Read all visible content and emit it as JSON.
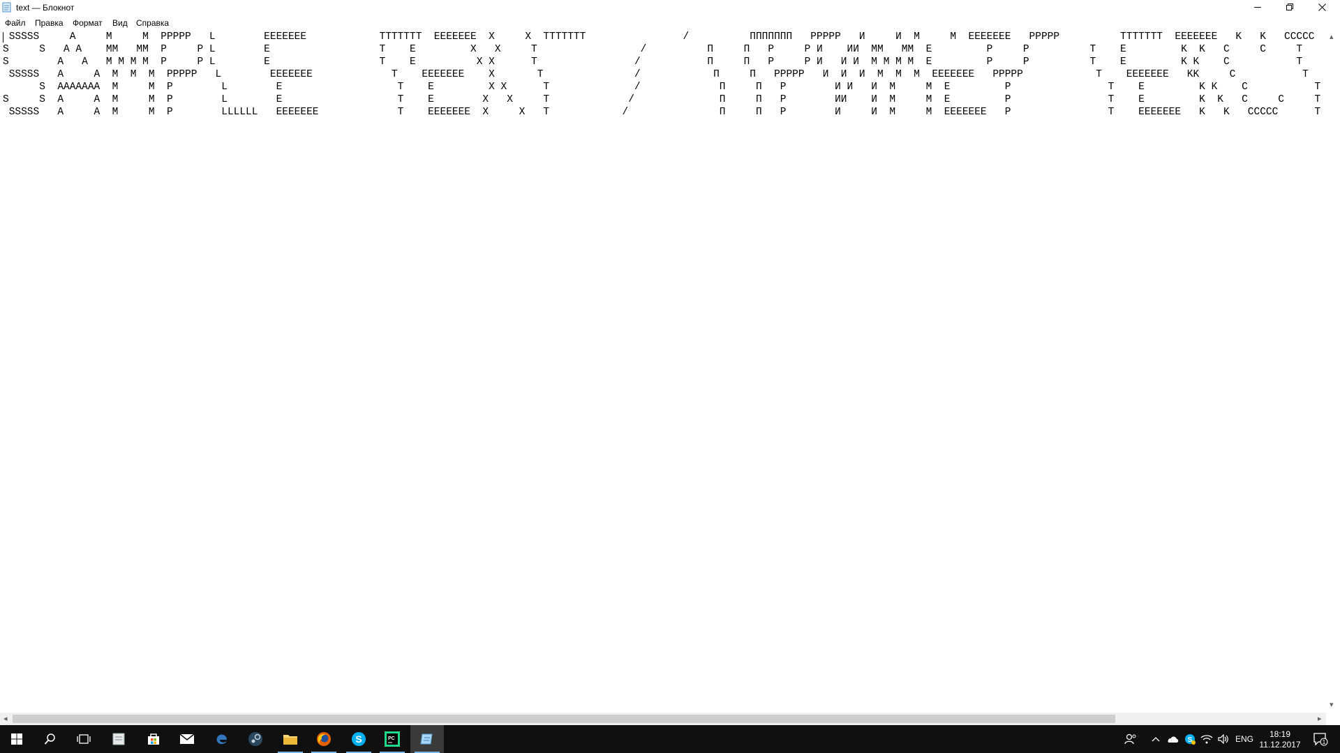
{
  "window": {
    "title": "text — Блокнот",
    "icon": "notepad-icon",
    "controls": [
      "minimize-icon",
      "restore-icon",
      "close-icon"
    ]
  },
  "menu": {
    "file": "Файл",
    "edit": "Правка",
    "format": "Формат",
    "view": "Вид",
    "help": "Справка"
  },
  "editor": {
    "content": " SSSSS     A     M     M  PPPPP   L        EEEEEEE            TTTTTTT  EEEEEEE  X     X  TTTTTTT                /          ППППППП   PPPPP   И     И  M     M  EEEEEEE   PPPPP          TTTTTTT  EEEEEEE   K   K   CCCCC   TTTTTTT     A              /\nS     S   A A    MM   MM  P     P L        E                  T    E         X   X     T                 /          П     П   P     P И    ИИ  MM   MM  E         P     P          T    E         K  K   C     C     T       A A            /\nS        A   A   M M M M  P     P L        E                  T    E          X X      T                /           П     П   P     P И   И И  M M M M  E         P     P          T    E         K K    C           T      A   A          /\n SSSSS   A     A  M  M  M  PPPPP   L        EEEEEEE             T    EEEEEEE    X       T               /            П     П   PPPPP   И  И  И  M  M  M  EEEEEEE   PPPPP            T    EEEEEEE   KK     C           T     A     A        /\n      S  AAAAAAA  M     M  P        L        E                   T    E         X X      T              /             П     П   P        И И   И  M     M  E         P                T    E         K K    C           T     AAAAAAA        /\nS     S  A     A  M     M  P        L        E                   T    E        X   X     T             /              П     П   P        ИИ    И  M     M  E         P                T    E         K  K   C     C     T     A     A       /\n SSSSS   A     A  M     M  P        LLLLLL   EEEEEEE             T    EEEEEEE  X     X   T            /               П     П   P        И     И  M     M  EEEEEEE   P                T    EEEEEEE   K   K   CCCCC      T     A     A      /"
  },
  "taskbar": {
    "apps": [
      "start-windows-icon",
      "search-icon",
      "task-view-icon",
      "notepad-app-icon",
      "store-icon",
      "mail-icon",
      "edge-icon",
      "steam-icon",
      "file-explorer-icon",
      "firefox-icon",
      "skype-icon",
      "pycharm-icon",
      "notepad-active-icon"
    ],
    "tray": [
      "people-icon",
      "chevron-up-icon",
      "onedrive-icon",
      "skype-tray-icon",
      "wifi-icon",
      "volume-icon"
    ],
    "language": "ENG",
    "time": "18:19",
    "date": "11.12.2017",
    "notifications": "1"
  },
  "colors": {
    "taskbar": "#101010",
    "active_underline": "#76b9ed",
    "text": "#000000",
    "scroll_thumb": "#cdcdcd"
  }
}
